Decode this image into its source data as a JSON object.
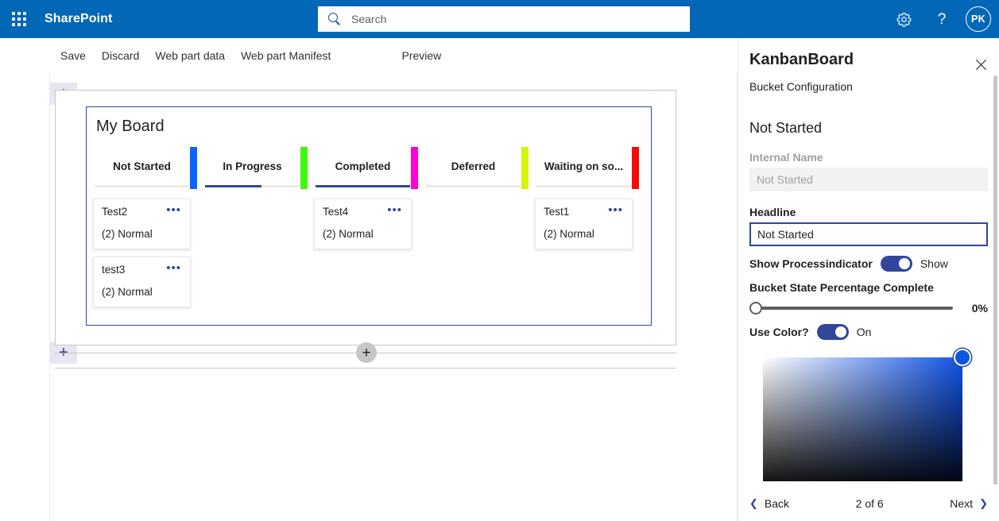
{
  "suite": {
    "waffle_icon": "app-launcher-icon",
    "brand": "SharePoint",
    "search_placeholder": "Search",
    "search_value": "",
    "settings_icon": "gear-icon",
    "help_icon": "help-icon",
    "avatar_initials": "PK",
    "bar_color": "#0367b8"
  },
  "command_bar": {
    "save": "Save",
    "discard": "Discard",
    "web_part_data": "Web part data",
    "web_part_manifest": "Web part Manifest",
    "preview": "Preview"
  },
  "section_rail": {
    "add_top_icon": "plus-icon",
    "edit_section_icon": "edit-section-icon",
    "move_icon": "move-icon",
    "duplicate_icon": "duplicate-icon",
    "delete_icon": "trash-icon",
    "add_bottom_icon": "plus-icon"
  },
  "webpart_toolbar": {
    "edit_icon": "pencil-icon",
    "move_icon": "move-icon",
    "copy_icon": "copy-icon",
    "delete_icon": "trash-icon"
  },
  "board": {
    "title": "My Board",
    "add_section_icon": "plus-icon",
    "columns": [
      {
        "name": "Not Started",
        "accent": "#0a64ff",
        "percent": 0,
        "cards": [
          {
            "title": "Test2",
            "meta": "(2) Normal",
            "menu_icon": "ellipsis-icon"
          },
          {
            "title": "test3",
            "meta": "(2) Normal",
            "menu_icon": "ellipsis-icon"
          }
        ]
      },
      {
        "name": "In Progress",
        "accent": "#3dfa0a",
        "percent": 60,
        "cards": []
      },
      {
        "name": "Completed",
        "accent": "#ff00dd",
        "percent": 100,
        "cards": [
          {
            "title": "Test4",
            "meta": "(2) Normal",
            "menu_icon": "ellipsis-icon"
          }
        ]
      },
      {
        "name": "Deferred",
        "accent": "#d7f50a",
        "percent": 0,
        "cards": []
      },
      {
        "name": "Waiting on so...",
        "accent": "#fa0a0a",
        "percent": 0,
        "cards": [
          {
            "title": "Test1",
            "meta": "(2) Normal",
            "menu_icon": "ellipsis-icon"
          }
        ]
      }
    ]
  },
  "pane": {
    "title": "KanbanBoard",
    "close_icon": "close-icon",
    "subtitle": "Bucket Configuration",
    "bucket_name": "Not Started",
    "internal_name_label": "Internal Name",
    "internal_name_value": "Not Started",
    "headline_label": "Headline",
    "headline_value": "Not Started",
    "show_indicator_label": "Show Processindicator",
    "show_indicator_state": "Show",
    "percent_label": "Bucket State Percentage Complete",
    "percent_value": "0%",
    "use_color_label": "Use Color?",
    "use_color_state": "On",
    "selected_color": "#0b58e0",
    "back": "Back",
    "back_icon": "chevron-left-icon",
    "page_indicator": "2 of 6",
    "next": "Next",
    "next_icon": "chevron-right-icon"
  }
}
